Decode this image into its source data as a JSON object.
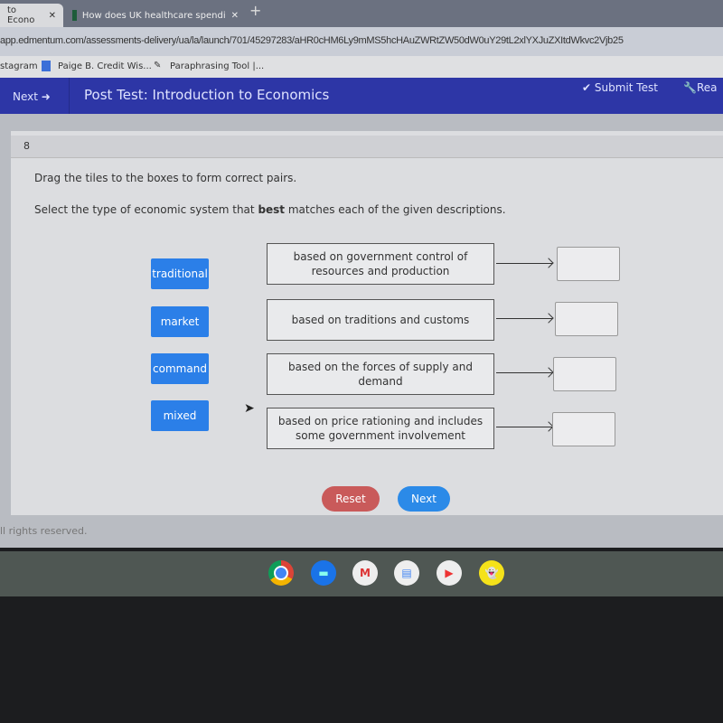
{
  "browser": {
    "tabs": [
      {
        "label": "to Econo"
      },
      {
        "label": "How does UK healthcare spendi"
      }
    ],
    "new_tab": "+",
    "url": "app.edmentum.com/assessments-delivery/ua/la/launch/701/45297283/aHR0cHM6Ly9mMS5hcHAuZWRtZW50dW0uY29tL2xlYXJuZXItdWkvc2Vjb25",
    "bookmarks": [
      "stagram",
      "Paige B. Credit Wis...",
      "Paraphrasing Tool |..."
    ]
  },
  "header": {
    "next_label": "Next",
    "title": "Post Test: Introduction to Economics",
    "submit_label": "Submit Test",
    "read_label": "Rea",
    "color": "#2d36a6"
  },
  "question": {
    "number": "8",
    "instruction": "Drag the tiles to the boxes to form correct pairs.",
    "prompt_pre": "Select the type of economic system that ",
    "prompt_bold": "best",
    "prompt_post": " matches each of the given descriptions.",
    "tiles": [
      "traditional",
      "market",
      "command",
      "mixed"
    ],
    "descriptions": [
      "based on government control of resources and production",
      "based on traditions and customs",
      "based on the forces of supply and demand",
      "based on price rationing and includes some government involvement"
    ]
  },
  "buttons": {
    "reset": "Reset",
    "next": "Next"
  },
  "footer": "ll rights reserved.",
  "shelf": [
    "chrome",
    "files",
    "gmail",
    "docs",
    "youtube",
    "snapchat"
  ]
}
